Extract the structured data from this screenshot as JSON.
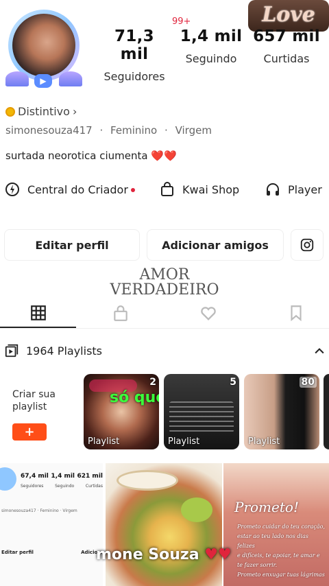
{
  "header": {
    "notification_count": "99+",
    "sticker_text": "Love",
    "stats": [
      {
        "num": "71,3 mil",
        "label": "Seguidores"
      },
      {
        "num": "1,4 mil",
        "label": "Seguindo"
      },
      {
        "num": "657 mil",
        "label": "Curtidas"
      }
    ]
  },
  "profile": {
    "badge_label": "Distintivo",
    "badge_chevron": "›",
    "username": "simonesouza417",
    "gender": "Feminino",
    "sign": "Virgem",
    "separator": "·",
    "bio": "surtada neorotica ciumenta ❤️❤️"
  },
  "tools": {
    "creator": "Central do Criador",
    "shop": "Kwai Shop",
    "player": "Player"
  },
  "buttons": {
    "edit": "Editar perfil",
    "add": "Adicionar amigos"
  },
  "overlay_text": {
    "line1": "AMOR",
    "line2": "VERDADEIRO"
  },
  "playlists": {
    "title": "1964 Playlists",
    "create_label": "Criar sua playlist",
    "create_button": "+",
    "cards": [
      {
        "count": "2",
        "label": "Playlist",
        "caption": "só querem"
      },
      {
        "count": "5",
        "label": "Playlist"
      },
      {
        "count": "80",
        "label": "Playlist"
      }
    ]
  },
  "grid": {
    "thumb1_stats": [
      "67,4 mil",
      "1,4 mil",
      "621 mil"
    ],
    "thumb1_labels": [
      "Seguidores",
      "Seguindo",
      "Curtidas"
    ],
    "thumb1_meta": "simonesouza417 · Feminino · Virgem",
    "thumb1_buttons": [
      "Editar perfil",
      "Adiciona"
    ],
    "thumb3_title": "Prometo!",
    "thumb3_lines": [
      "Prometo cuidar do teu coração,",
      "estar ao teu lado nos dias felizes",
      "e difíceis, te apoiar, te amar e",
      "te fazer sorrir.",
      "Prometo enxugar tuas lágrimas"
    ],
    "watermark": "mone Souza"
  },
  "colors": {
    "accent": "#ff4e18",
    "notif": "#e0243c"
  }
}
